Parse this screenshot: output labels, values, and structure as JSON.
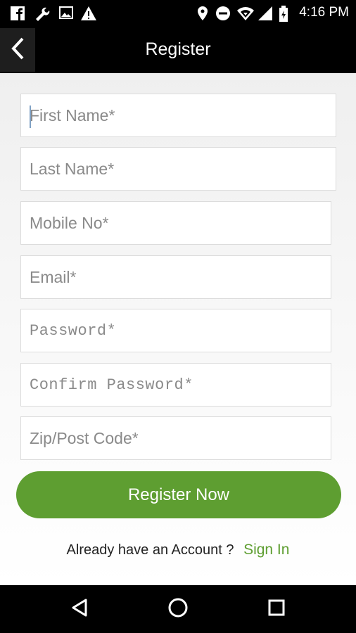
{
  "status_bar": {
    "time": "4:16 PM",
    "icons": [
      "facebook-icon",
      "wrench-icon",
      "image-icon",
      "warning-icon",
      "location-icon",
      "dnd-icon",
      "wifi-icon",
      "signal-icon",
      "battery-icon"
    ]
  },
  "app_bar": {
    "title": "Register",
    "back_icon": "chevron-left-icon"
  },
  "form": {
    "first_name": {
      "placeholder": "First Name*",
      "value": ""
    },
    "last_name": {
      "placeholder": "Last Name*",
      "value": ""
    },
    "mobile": {
      "placeholder": "Mobile No*",
      "value": ""
    },
    "email": {
      "placeholder": "Email*",
      "value": ""
    },
    "password": {
      "placeholder": "Password*",
      "value": ""
    },
    "confirm_password": {
      "placeholder": "Confirm Password*",
      "value": ""
    },
    "zip": {
      "placeholder": "Zip/Post Code*",
      "value": ""
    }
  },
  "register_button": {
    "label": "Register Now"
  },
  "signin": {
    "prompt": "Already have an Account ?",
    "link": "Sign In"
  },
  "nav_bar": {
    "icons": [
      "back-triangle-icon",
      "home-circle-icon",
      "recents-square-icon"
    ]
  },
  "colors": {
    "accent": "#5e9e31",
    "bar": "#000000",
    "background": "#f2f2f2"
  }
}
